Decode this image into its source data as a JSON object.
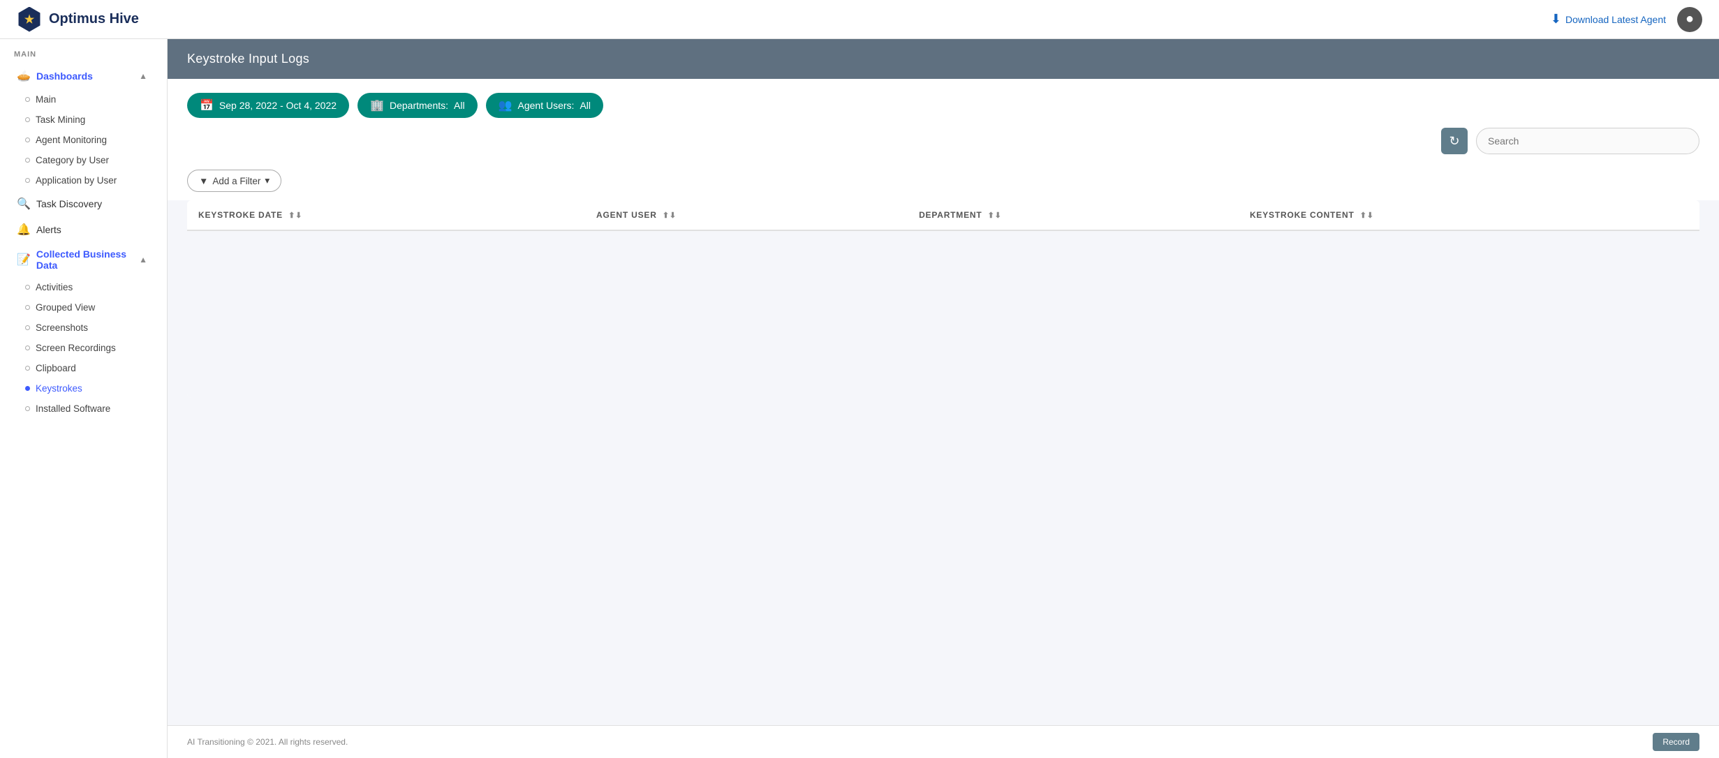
{
  "brand": {
    "name": "Optimus Hive",
    "logo_char": "★"
  },
  "navbar": {
    "download_label": "Download Latest Agent",
    "avatar_label": "User Avatar"
  },
  "sidebar": {
    "section_main": "MAIN",
    "dashboards_label": "Dashboards",
    "dashboards_sub": [
      {
        "id": "main",
        "label": "Main"
      },
      {
        "id": "task-mining",
        "label": "Task Mining"
      },
      {
        "id": "agent-monitoring",
        "label": "Agent Monitoring"
      },
      {
        "id": "category-by-user",
        "label": "Category by User"
      },
      {
        "id": "application-by-user",
        "label": "Application by User"
      }
    ],
    "task_discovery_label": "Task Discovery",
    "alerts_label": "Alerts",
    "collected_label": "Collected Business Data",
    "collected_sub": [
      {
        "id": "activities",
        "label": "Activities"
      },
      {
        "id": "grouped-view",
        "label": "Grouped View"
      },
      {
        "id": "screenshots",
        "label": "Screenshots"
      },
      {
        "id": "screen-recordings",
        "label": "Screen Recordings"
      },
      {
        "id": "clipboard",
        "label": "Clipboard"
      },
      {
        "id": "keystrokes",
        "label": "Keystrokes",
        "active": true
      },
      {
        "id": "installed-software",
        "label": "Installed Software"
      }
    ]
  },
  "page": {
    "title": "Keystroke Input Logs"
  },
  "filters": {
    "date_range": "Sep 28, 2022 - Oct 4, 2022",
    "departments_label": "Departments:",
    "departments_value": "All",
    "agent_users_label": "Agent Users:",
    "agent_users_value": "All"
  },
  "toolbar": {
    "refresh_label": "↻",
    "search_placeholder": "Search"
  },
  "filter_row": {
    "add_filter_label": "Add a Filter",
    "filter_icon": "▼"
  },
  "table": {
    "columns": [
      {
        "id": "keystroke-date",
        "label": "KEYSTROKE DATE",
        "sortable": true
      },
      {
        "id": "agent-user",
        "label": "AGENT USER",
        "sortable": true
      },
      {
        "id": "department",
        "label": "DEPARTMENT",
        "sortable": true
      },
      {
        "id": "keystroke-content",
        "label": "KEYSTROKE CONTENT",
        "sortable": true
      }
    ],
    "rows": []
  },
  "footer": {
    "copyright": "AI Transitioning © 2021. All rights reserved.",
    "record_btn_label": "Record"
  },
  "colors": {
    "teal": "#00897b",
    "navy": "#1a2e5a",
    "header_bg": "#5f7080",
    "accent_blue": "#3d5afe",
    "link_blue": "#1565c0",
    "toolbar_gray": "#607d8b"
  }
}
